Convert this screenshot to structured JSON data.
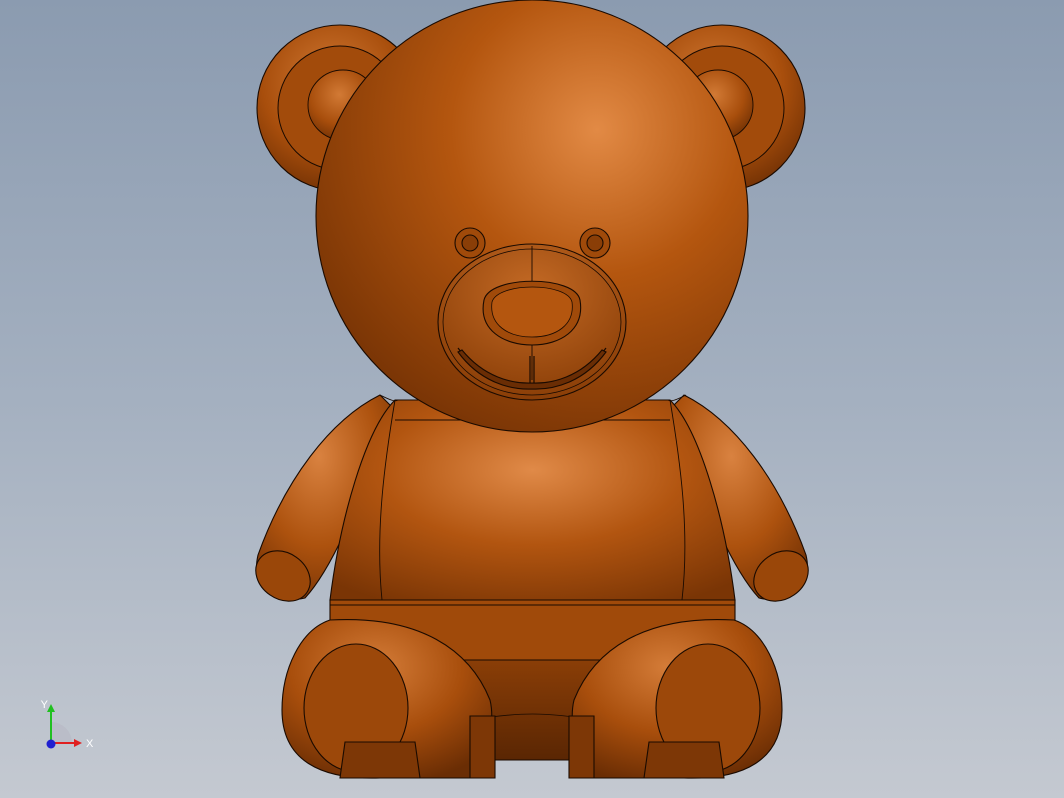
{
  "viewport": {
    "background_top": "#8b9bb0",
    "background_bottom": "#c4c9d1"
  },
  "model": {
    "name": "teddy-bear",
    "material_color": "#b4560f",
    "edge_color": "#1a0a00"
  },
  "triad": {
    "x_label": "X",
    "y_label": "Y",
    "x_color": "#e02020",
    "y_color": "#20c020",
    "z_color": "#2020d0"
  }
}
